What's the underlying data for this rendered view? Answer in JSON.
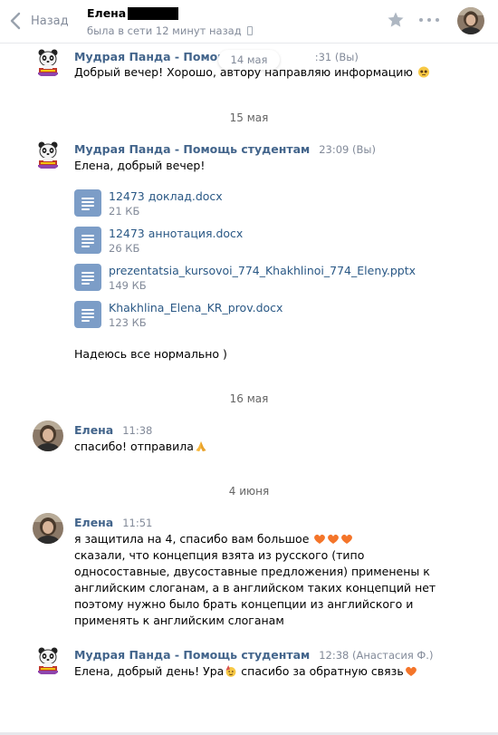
{
  "header": {
    "back_label": "Назад",
    "peer_name": "Елена",
    "peer_status": "была в сети 12 минут назад"
  },
  "floating_date": "14 мая",
  "messages": {
    "m1": {
      "sender": "Мудрая Панда - Помощь с",
      "time": ":31 (Вы)",
      "text": "Добрый вечер! Хорошо, автору направляю информацию"
    },
    "date2": "15 мая",
    "m2": {
      "sender": "Мудрая Панда - Помощь студентам",
      "time": "23:09 (Вы)",
      "text": "Елена, добрый вечер!",
      "docs": [
        {
          "name": "12473 доклад.docx",
          "size": "21 КБ"
        },
        {
          "name": "12473 аннотация.docx",
          "size": "26 КБ"
        },
        {
          "name": "prezentatsia_kursovoi_774_Khakhlinoi_774_Eleny.pptx",
          "size": "149 КБ"
        },
        {
          "name": "Khakhlina_Elena_KR_prov.docx",
          "size": "123 КБ"
        }
      ],
      "text2": "Надеюсь все нормально )"
    },
    "date3": "16 мая",
    "m3": {
      "sender": "Елена",
      "time": "11:38",
      "text": "спасибо! отправила"
    },
    "date4": "4 июня",
    "m4": {
      "sender": "Елена",
      "time": "11:51",
      "lines": [
        "я защитила на 4, спасибо вам большое",
        "сказали, что концепция взята из русского (типо",
        "односоставные, двусоставные предложения) применены к",
        "английским слоганам, а в английском таких концепций нет",
        "поэтому нужно было брать концепции из английского и",
        "применять к английским слоганам"
      ]
    },
    "m5": {
      "sender": "Мудрая Панда - Помощь студентам",
      "time": "12:38 (Анастасия Ф.)",
      "text_a": "Елена, добрый день! Ура",
      "text_b": " спасибо за обратную связь"
    }
  },
  "colors": {
    "sender": "#42648b",
    "link": "#2a5885",
    "muted": "#828a99",
    "doc_icon": "#7c9dc7",
    "heart": "#f4752a"
  },
  "icons": [
    "chevron-left-icon",
    "star-icon",
    "more-icon",
    "phone-icon",
    "doc-icon",
    "panda-avatar",
    "heart-icon",
    "pleading-face-icon",
    "praying-hands-icon",
    "party-face-icon"
  ]
}
